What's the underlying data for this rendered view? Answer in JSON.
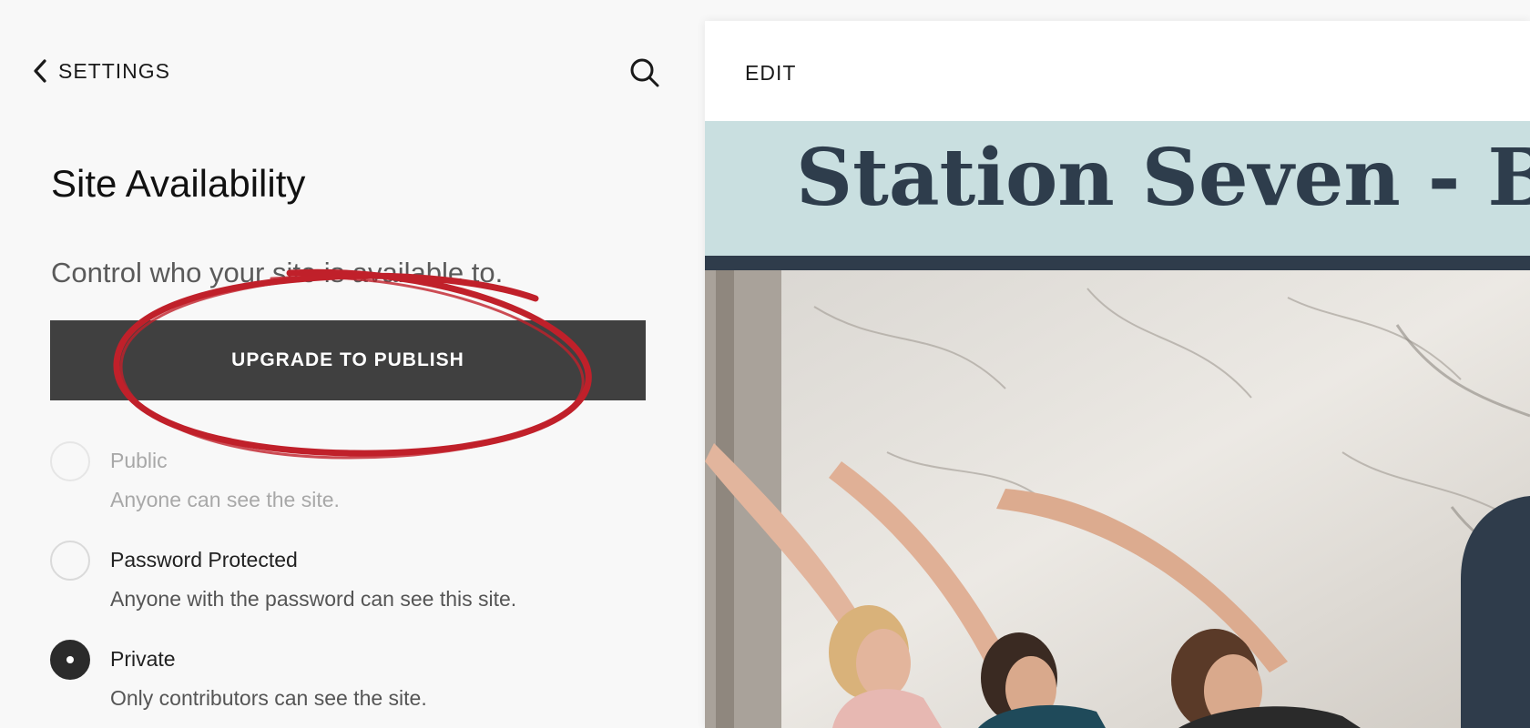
{
  "sidebar": {
    "back_label": "SETTINGS",
    "title": "Site Availability",
    "subtitle": "Control who your site is available to.",
    "upgrade_label": "UPGRADE TO PUBLISH",
    "options": [
      {
        "label": "Public",
        "description": "Anyone can see the site.",
        "selected": false,
        "disabled": true
      },
      {
        "label": "Password Protected",
        "description": "Anyone with the password can see this site.",
        "selected": false,
        "disabled": false
      },
      {
        "label": "Private",
        "description": "Only contributors can see the site.",
        "selected": true,
        "disabled": false
      }
    ]
  },
  "preview": {
    "edit_label": "EDIT",
    "site_title": "Station Seven - Blog"
  },
  "colors": {
    "accent_button": "#404040",
    "annotation_red": "#c0202a",
    "banner_bg": "#c9dfe0",
    "banner_text": "#2e3d4c"
  },
  "icons": [
    "chevron-left-icon",
    "search-icon"
  ]
}
